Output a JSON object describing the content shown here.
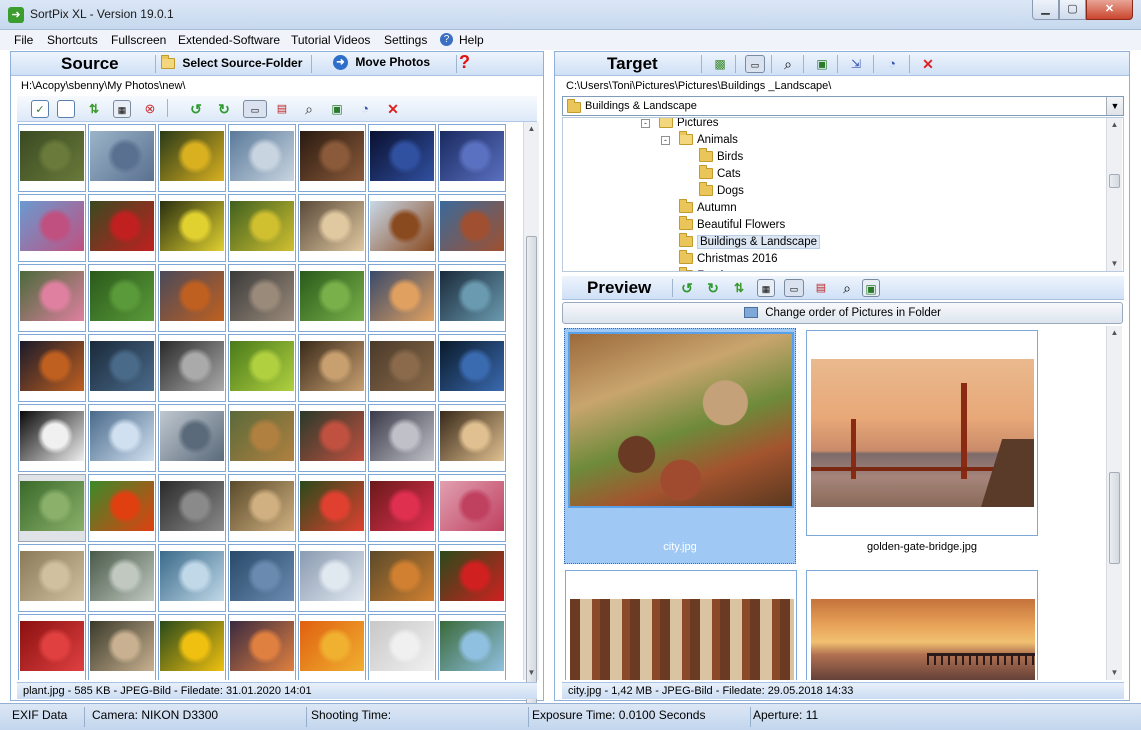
{
  "window": {
    "title": "SortPix XL - Version 19.0.1"
  },
  "menu": [
    "File",
    "Shortcuts",
    "Fullscreen",
    "Extended-Software",
    "Tutorial Videos",
    "Settings",
    "Help"
  ],
  "source": {
    "title": "Source",
    "select_folder": "Select Source-Folder",
    "move_photos": "Move Photos",
    "path": "H:\\Acopy\\sbenny\\My Photos\\new\\",
    "status": "plant.jpg - 585 KB - JPEG-Bild - Filedate: 31.01.2020 14:01"
  },
  "target": {
    "title": "Target",
    "path": "C:\\Users\\Toni\\Pictures\\Pictures\\Buildings _Landscape\\",
    "selected_folder": "Buildings & Landscape",
    "tree": [
      {
        "label": "Pictures",
        "indent": 0,
        "expander": "-"
      },
      {
        "label": "Animals",
        "indent": 1,
        "expander": "-"
      },
      {
        "label": "Birds",
        "indent": 2
      },
      {
        "label": "Cats",
        "indent": 2
      },
      {
        "label": "Dogs",
        "indent": 2
      },
      {
        "label": "Autumn",
        "indent": 1
      },
      {
        "label": "Beautiful Flowers",
        "indent": 1
      },
      {
        "label": "Buildings & Landscape",
        "indent": 1,
        "selected": true
      },
      {
        "label": "Christmas 2016",
        "indent": 1
      },
      {
        "label": "Food",
        "indent": 1
      }
    ]
  },
  "preview": {
    "title": "Preview",
    "change_order": "Change order of Pictures in Folder",
    "items": [
      "city.jpg",
      "golden-gate-bridge.jpg",
      "",
      ""
    ],
    "status": "city.jpg - 1,42 MB - JPEG-Bild - Filedate: 29.05.2018 14:33"
  },
  "exif": {
    "label": "EXIF Data",
    "camera": "Camera: NIKON D3300",
    "shooting_time": "Shooting Time:",
    "exposure": "Exposure Time: 0.0100 Seconds",
    "aperture": "Aperture: 11"
  },
  "colors": {
    "accent_blue": "#3d6ea8",
    "selection": "#9fc8f5",
    "header_gradient_top": "#eef4fc"
  }
}
